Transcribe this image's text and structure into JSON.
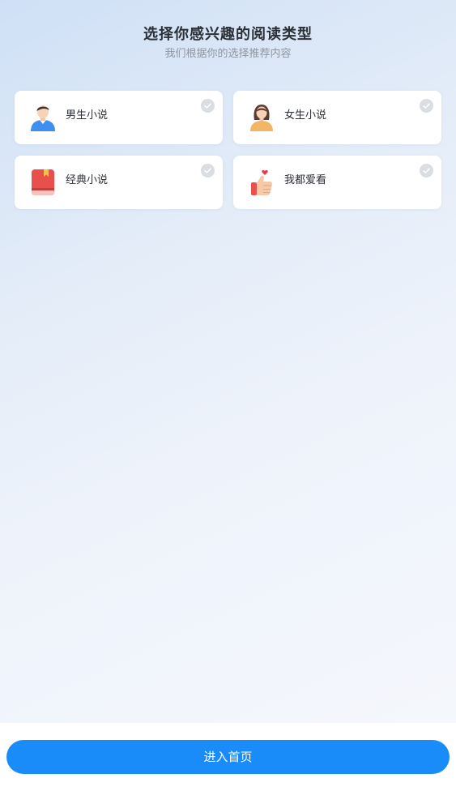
{
  "header": {
    "title": "选择你感兴趣的阅读类型",
    "subtitle": "我们根据你的选择推荐内容"
  },
  "options": [
    {
      "label": "男生小说",
      "icon": "male-avatar-icon",
      "selected": false
    },
    {
      "label": "女生小说",
      "icon": "female-avatar-icon",
      "selected": false
    },
    {
      "label": "经典小说",
      "icon": "red-book-icon",
      "selected": false
    },
    {
      "label": "我都爱看",
      "icon": "thumbs-up-heart-icon",
      "selected": false
    }
  ],
  "footer": {
    "enter_label": "进入首页"
  },
  "colors": {
    "primary": "#1a8cfa",
    "check_inactive": "#dadde2",
    "title": "#2b2f36",
    "subtitle": "#8f959e"
  }
}
